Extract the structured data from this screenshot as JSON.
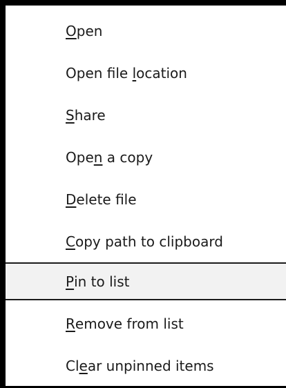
{
  "menu": {
    "items": [
      {
        "before": "",
        "mnemonic": "O",
        "after": "pen"
      },
      {
        "before": "Open file ",
        "mnemonic": "l",
        "after": "ocation"
      },
      {
        "before": "",
        "mnemonic": "S",
        "after": "hare"
      },
      {
        "before": "Ope",
        "mnemonic": "n",
        "after": " a copy"
      },
      {
        "before": "",
        "mnemonic": "D",
        "after": "elete file"
      },
      {
        "before": "",
        "mnemonic": "C",
        "after": "opy path to clipboard"
      },
      {
        "before": "",
        "mnemonic": "P",
        "after": "in to list",
        "highlighted": true
      },
      {
        "before": "",
        "mnemonic": "R",
        "after": "emove from list"
      },
      {
        "before": "Cl",
        "mnemonic": "e",
        "after": "ar unpinned items"
      }
    ]
  }
}
